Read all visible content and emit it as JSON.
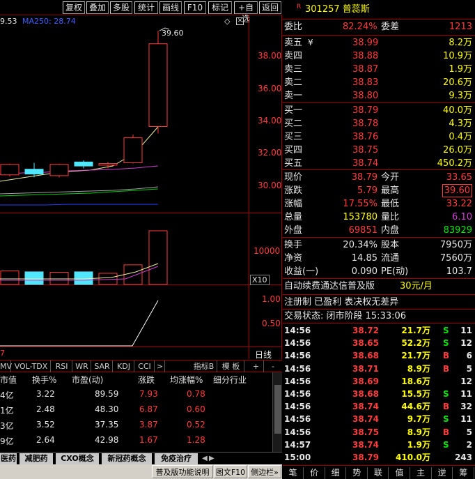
{
  "toolbar": {
    "buttons": [
      "复权",
      "叠加",
      "多股",
      "统计",
      "画线",
      "F10",
      "标记",
      "+自选",
      "返回"
    ]
  },
  "chart": {
    "ma_label_a": "9.53",
    "ma_label_b": "MA250: 28.74",
    "high_marker": "39.60",
    "price_axis": [
      "38.00",
      "36.00",
      "34.00",
      "32.00",
      "30.00"
    ],
    "volume_axis": [
      "10000"
    ],
    "volume_unit": "X10",
    "ind_axis": [
      "1.00",
      "0.50"
    ],
    "date_fragment": "7",
    "period_label": "日线",
    "candles": [
      {
        "open": 30.65,
        "close": 31.3,
        "high": 31.35,
        "low": 30.55
      },
      {
        "open": 31.0,
        "close": 30.7,
        "high": 31.4,
        "low": 30.5
      },
      {
        "open": 30.6,
        "close": 31.3,
        "high": 31.35,
        "low": 30.5
      },
      {
        "open": 31.45,
        "close": 31.2,
        "high": 31.55,
        "low": 31.05
      },
      {
        "open": 31.25,
        "close": 31.35,
        "high": 31.45,
        "low": 31.05
      },
      {
        "open": 31.4,
        "close": 32.95,
        "high": 33.15,
        "low": 31.35
      },
      {
        "open": 33.65,
        "close": 38.79,
        "high": 39.6,
        "low": 33.22
      }
    ],
    "volumes": [
      {
        "v": 2900,
        "up": true
      },
      {
        "v": 2700,
        "up": false
      },
      {
        "v": 2600,
        "up": true
      },
      {
        "v": 2700,
        "up": false
      },
      {
        "v": 2400,
        "up": true
      },
      {
        "v": 4200,
        "up": true
      },
      {
        "v": 11500,
        "up": true
      }
    ],
    "indicator_line": [
      0.0,
      0.0,
      0.0,
      0.0,
      0.0,
      0.0,
      0.93
    ]
  },
  "indicator_tabs": [
    "MV",
    "VOL-TDX",
    "RSI",
    "WR",
    "SAR",
    "KDJ",
    "CCI",
    ">",
    "指标B",
    "模 板",
    "+",
    "-"
  ],
  "table": {
    "headers": [
      "市值",
      "换手%",
      "市盈(动)",
      "涨跌",
      "均涨幅%",
      "细分行业"
    ],
    "rows": [
      {
        "mv": "4亿",
        "turnover": "3.22",
        "pe": "89.59",
        "chg": "7.93",
        "avg": "0.78"
      },
      {
        "mv": "1亿",
        "turnover": "2.48",
        "pe": "48.30",
        "chg": "6.87",
        "avg": "0.60"
      },
      {
        "mv": "3亿",
        "turnover": "3.52",
        "pe": "37.35",
        "chg": "3.87",
        "avg": "0.52"
      },
      {
        "mv": "9亿",
        "turnover": "2.64",
        "pe": "42.98",
        "chg": "1.67",
        "avg": "1.28"
      }
    ]
  },
  "concept_tabs": [
    "医药",
    "减肥药",
    "CXO概念",
    "新冠药概念",
    "免疫治疗"
  ],
  "status_bar": {
    "btn1": "普及版功能说明",
    "btn2": "图文F10",
    "btn3": "侧边栏»"
  },
  "quote": {
    "badge": "R",
    "code_name": "301257 普蕊斯",
    "weibi_label": "委比",
    "weibi": "82.24%",
    "weicha_label": "委差",
    "weicha": "1213",
    "asks": [
      {
        "label": "卖五",
        "mark": "¥",
        "price": "38.99",
        "vol": "8.2万"
      },
      {
        "label": "卖四",
        "mark": "",
        "price": "38.88",
        "vol": "10.9万"
      },
      {
        "label": "卖三",
        "mark": "",
        "price": "38.87",
        "vol": "1.9万"
      },
      {
        "label": "卖二",
        "mark": "",
        "price": "38.83",
        "vol": "20.6万"
      },
      {
        "label": "卖一",
        "mark": "",
        "price": "38.80",
        "vol": "9.3万"
      }
    ],
    "bids": [
      {
        "label": "买一",
        "price": "38.79",
        "vol": "40.0万"
      },
      {
        "label": "买二",
        "price": "38.78",
        "vol": "4.3万"
      },
      {
        "label": "买三",
        "price": "38.76",
        "vol": "0.4万"
      },
      {
        "label": "买四",
        "price": "38.75",
        "vol": "26.0万"
      },
      {
        "label": "买五",
        "price": "38.74",
        "vol": "450.2万"
      }
    ],
    "stats1": [
      {
        "l1": "现价",
        "v1": "38.79",
        "l2": "今开",
        "v2": "33.65"
      },
      {
        "l1": "涨跌",
        "v1": "5.79",
        "l2": "最高",
        "v2": "39.60"
      },
      {
        "l1": "涨幅",
        "v1": "17.55%",
        "l2": "最低",
        "v2": "33.22"
      },
      {
        "l1": "总量",
        "v1": "153780",
        "l2": "量比",
        "v2": "6.10"
      },
      {
        "l1": "外盘",
        "v1": "69851",
        "l2": "内盘",
        "v2": "83929"
      }
    ],
    "stats2": [
      {
        "l1": "换手",
        "v1": "20.34%",
        "l2": "股本",
        "v2": "7950万"
      },
      {
        "l1": "净资",
        "v1": "14.85",
        "l2": "流通",
        "v2": "7560万"
      },
      {
        "l1": "收益(一)",
        "v1": "0.090",
        "l2": "PE(动)",
        "v2": "103.7"
      }
    ],
    "promo_text": "自动续费通达信普及版",
    "promo_price": "30元/月",
    "info": "注册制 已盈利 表决权无差异",
    "trade_status": "交易状态: 闭市阶段 15:33:06"
  },
  "ticks": [
    {
      "t": "14:56",
      "p": "38.72",
      "v": "21.7万",
      "bs": "S",
      "n": "11"
    },
    {
      "t": "14:56",
      "p": "38.65",
      "v": "52.2万",
      "bs": "S",
      "n": "12"
    },
    {
      "t": "14:56",
      "p": "38.68",
      "v": "21.7万",
      "bs": "B",
      "n": "6"
    },
    {
      "t": "14:56",
      "p": "38.71",
      "v": "8.9万",
      "bs": "B",
      "n": "5"
    },
    {
      "t": "14:56",
      "p": "38.69",
      "v": "18.6万",
      "bs": "",
      "n": "12"
    },
    {
      "t": "14:56",
      "p": "38.68",
      "v": "15.5万",
      "bs": "S",
      "n": "11"
    },
    {
      "t": "14:56",
      "p": "38.74",
      "v": "44.6万",
      "bs": "B",
      "n": "32"
    },
    {
      "t": "14:56",
      "p": "38.74",
      "v": "9.7万",
      "bs": "S",
      "n": "11"
    },
    {
      "t": "14:56",
      "p": "38.75",
      "v": "8.9万",
      "bs": "B",
      "n": "5"
    },
    {
      "t": "14:57",
      "p": "38.74",
      "v": "1.9万",
      "bs": "S",
      "n": "2"
    },
    {
      "t": "15:00",
      "p": "38.79",
      "v": "410.0万",
      "bs": "",
      "n": "243"
    }
  ],
  "right_tabs": [
    "笔",
    "价",
    "细",
    "势",
    "联",
    "值",
    "主",
    "逆",
    "筹"
  ],
  "colors": {
    "up": "#ff3c3c",
    "down": "#50e6ff",
    "grid": "#a00000",
    "price": "#ffff00"
  }
}
